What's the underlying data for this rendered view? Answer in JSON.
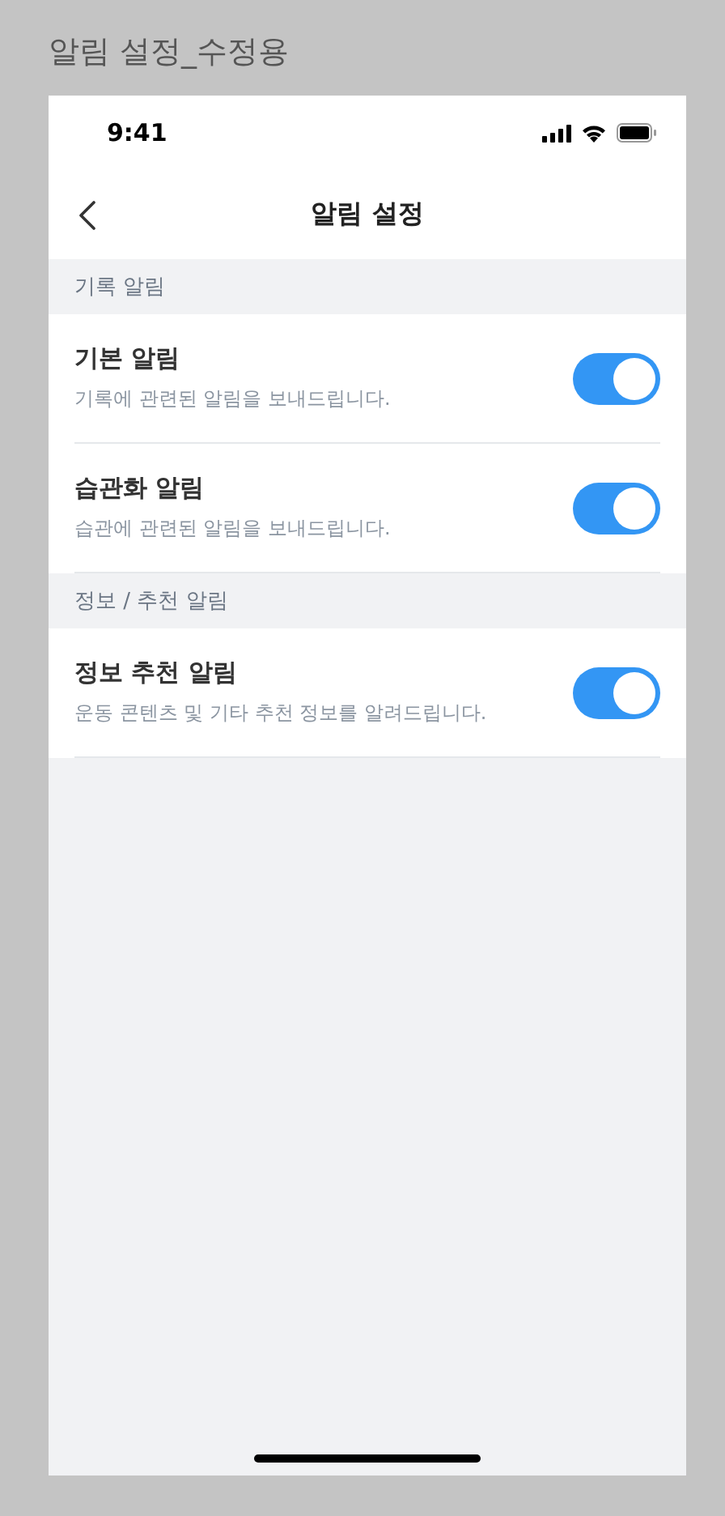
{
  "frame_title": "알림 설정_수정용",
  "status_bar": {
    "time": "9:41"
  },
  "nav": {
    "title": "알림 설정"
  },
  "sections": [
    {
      "header": "기록 알림",
      "items": [
        {
          "title": "기본 알림",
          "description": "기록에 관련된 알림을 보내드립니다.",
          "on": true
        },
        {
          "title": "습관화 알림",
          "description": "습관에 관련된 알림을 보내드립니다.",
          "on": true
        }
      ]
    },
    {
      "header": "정보 / 추천 알림",
      "items": [
        {
          "title": "정보 추천 알림",
          "description": "운동 콘텐츠 및 기타 추천 정보를 알려드립니다.",
          "on": true
        }
      ]
    }
  ]
}
